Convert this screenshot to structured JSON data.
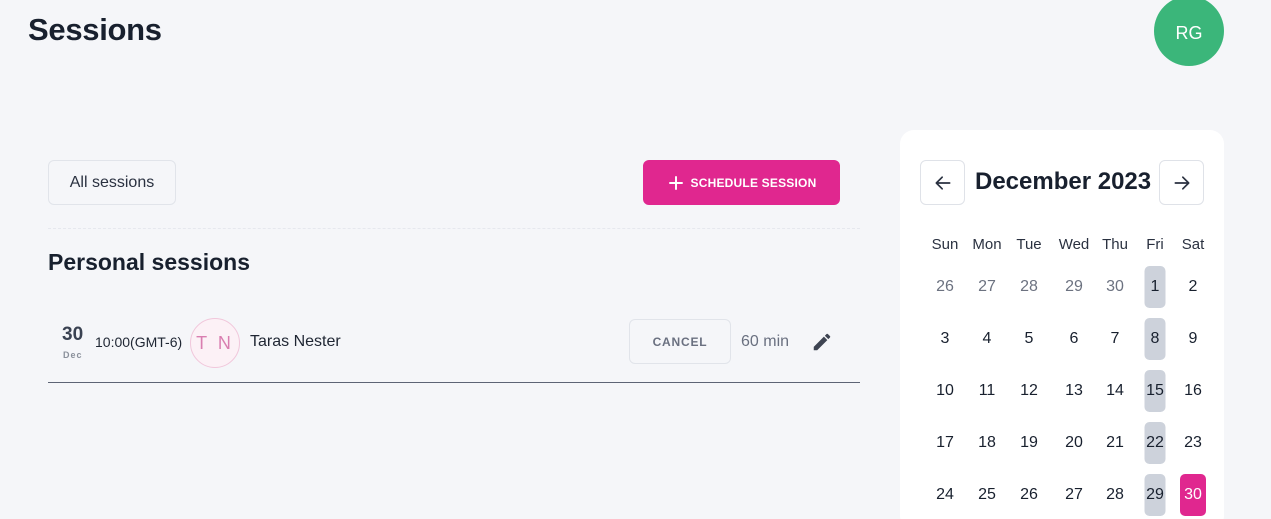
{
  "header": {
    "title": "Sessions",
    "avatar_initials": "RG"
  },
  "toolbar": {
    "filter_label": "All sessions",
    "schedule_label": "SCHEDULE SESSION"
  },
  "section": {
    "title": "Personal sessions"
  },
  "sessions": [
    {
      "day": "30",
      "month": "Dec",
      "time": "10:00(GMT-6)",
      "initials": "T N",
      "name": "Taras Nester",
      "cancel_label": "CANCEL",
      "duration": "60 min"
    }
  ],
  "calendar": {
    "month_label": "December 2023",
    "weekdays": [
      "Sun",
      "Mon",
      "Tue",
      "Wed",
      "Thu",
      "Fri",
      "Sat"
    ],
    "weeks": [
      [
        "26",
        "27",
        "28",
        "29",
        "30",
        "1",
        "2"
      ],
      [
        "3",
        "4",
        "5",
        "6",
        "7",
        "8",
        "9"
      ],
      [
        "10",
        "11",
        "12",
        "13",
        "14",
        "15",
        "16"
      ],
      [
        "17",
        "18",
        "19",
        "20",
        "21",
        "22",
        "23"
      ],
      [
        "24",
        "25",
        "26",
        "27",
        "28",
        "29",
        "30"
      ]
    ],
    "outside_month_days_in_first_week": 5,
    "highlighted_weekday": "Fri",
    "selected_day": "30"
  },
  "colors": {
    "accent": "#e0278f",
    "avatar": "#3bb67a",
    "friday_highlight": "#cdd2db"
  },
  "icons": {
    "schedule": "plus-icon",
    "edit": "pencil-icon",
    "prev": "arrow-left-icon",
    "next": "arrow-right-icon"
  }
}
